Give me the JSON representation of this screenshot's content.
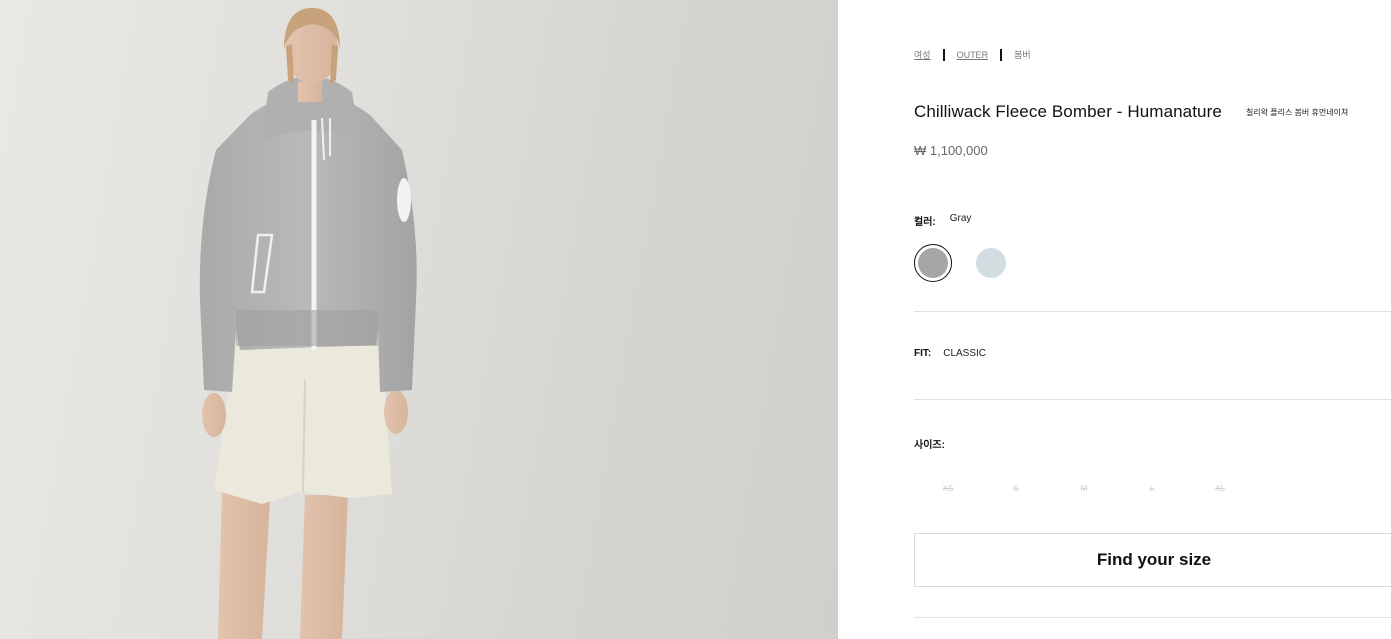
{
  "breadcrumb": [
    {
      "label": "여성"
    },
    {
      "label": "OUTER"
    },
    {
      "label": "봄버"
    }
  ],
  "product": {
    "title": "Chilliwack Fleece Bomber - Humanature",
    "subtitle": "칠리왁 플리스 봄버 휴먼네이쳐",
    "price": "₩ 1,100,000"
  },
  "color": {
    "label": "컬러:",
    "value": "Gray",
    "swatches": [
      {
        "name": "Gray",
        "color": "#a6a6a6",
        "selected": true
      },
      {
        "name": "Light Blue",
        "color": "#d3dce0",
        "selected": false
      }
    ]
  },
  "fit": {
    "label": "FIT:",
    "value": "CLASSIC"
  },
  "size": {
    "label": "사이즈:",
    "options": [
      "XS",
      "S",
      "M",
      "L",
      "XL"
    ],
    "available": [
      false,
      false,
      false,
      false,
      false
    ]
  },
  "find_size_label": "Find your size",
  "colors": {
    "background_image": "#dcdbd7",
    "text": "#111111",
    "muted": "#777777",
    "divider": "#e2e2e2"
  }
}
